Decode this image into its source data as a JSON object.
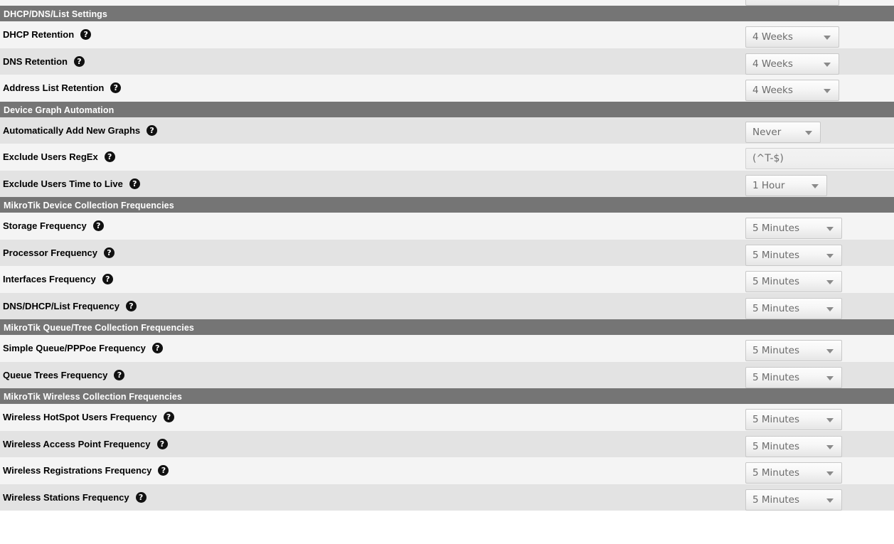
{
  "help_icon": "?",
  "colors": {
    "section_header_bg": "#757575",
    "section_header_text": "#ffffff",
    "row_odd_bg": "#f4f4f4",
    "row_even_bg": "#e3e3e3",
    "control_text": "#6b6b6b",
    "label_text": "#000000",
    "help_icon_bg": "#111111"
  },
  "sections": [
    {
      "title": "DHCP/DNS/List Settings",
      "rows": [
        {
          "label": "DHCP Retention",
          "control": "select",
          "value": "4 Weeks",
          "width": "sel-w-132",
          "offset": 7
        },
        {
          "label": "DNS Retention",
          "control": "select",
          "value": "4 Weeks",
          "width": "sel-w-132",
          "offset": 7
        },
        {
          "label": "Address List Retention",
          "control": "select",
          "value": "4 Weeks",
          "width": "sel-w-132",
          "offset": 7
        }
      ]
    },
    {
      "title": "Device Graph Automation",
      "rows": [
        {
          "label": "Automatically Add New Graphs",
          "control": "select",
          "value": "Never",
          "width": "sel-w-106",
          "offset": 6
        },
        {
          "label": "Exclude Users RegEx",
          "control": "text",
          "value": "(^T-$)",
          "width": "",
          "offset": 6
        },
        {
          "label": "Exclude Users Time to Live",
          "control": "select",
          "value": "1 Hour",
          "width": "sel-w-115",
          "offset": 6
        }
      ]
    },
    {
      "title": "MikroTik Device Collection Frequencies",
      "rows": [
        {
          "label": "Storage Frequency",
          "control": "select",
          "value": "5 Minutes",
          "width": "sel-w-136",
          "offset": 7
        },
        {
          "label": "Processor Frequency",
          "control": "select",
          "value": "5 Minutes",
          "width": "sel-w-136",
          "offset": 7
        },
        {
          "label": "Interfaces Frequency",
          "control": "select",
          "value": "5 Minutes",
          "width": "sel-w-136",
          "offset": 7
        },
        {
          "label": "DNS/DHCP/List Frequency",
          "control": "select",
          "value": "5 Minutes",
          "width": "sel-w-136",
          "offset": 7
        }
      ]
    },
    {
      "title": "MikroTik Queue/Tree Collection Frequencies",
      "rows": [
        {
          "label": "Simple Queue/PPPoe Frequency",
          "control": "select",
          "value": "5 Minutes",
          "width": "sel-w-136",
          "offset": 7
        },
        {
          "label": "Queue Trees Frequency",
          "control": "select",
          "value": "5 Minutes",
          "width": "sel-w-136",
          "offset": 7
        }
      ]
    },
    {
      "title": "MikroTik Wireless Collection Frequencies",
      "rows": [
        {
          "label": "Wireless HotSpot Users Frequency",
          "control": "select",
          "value": "5 Minutes",
          "width": "sel-w-136",
          "offset": 7
        },
        {
          "label": "Wireless Access Point Frequency",
          "control": "select",
          "value": "5 Minutes",
          "width": "sel-w-136",
          "offset": 7
        },
        {
          "label": "Wireless Registrations Frequency",
          "control": "select",
          "value": "5 Minutes",
          "width": "sel-w-136",
          "offset": 7
        },
        {
          "label": "Wireless Stations Frequency",
          "control": "select",
          "value": "5 Minutes",
          "width": "sel-w-136",
          "offset": 7
        }
      ]
    }
  ]
}
